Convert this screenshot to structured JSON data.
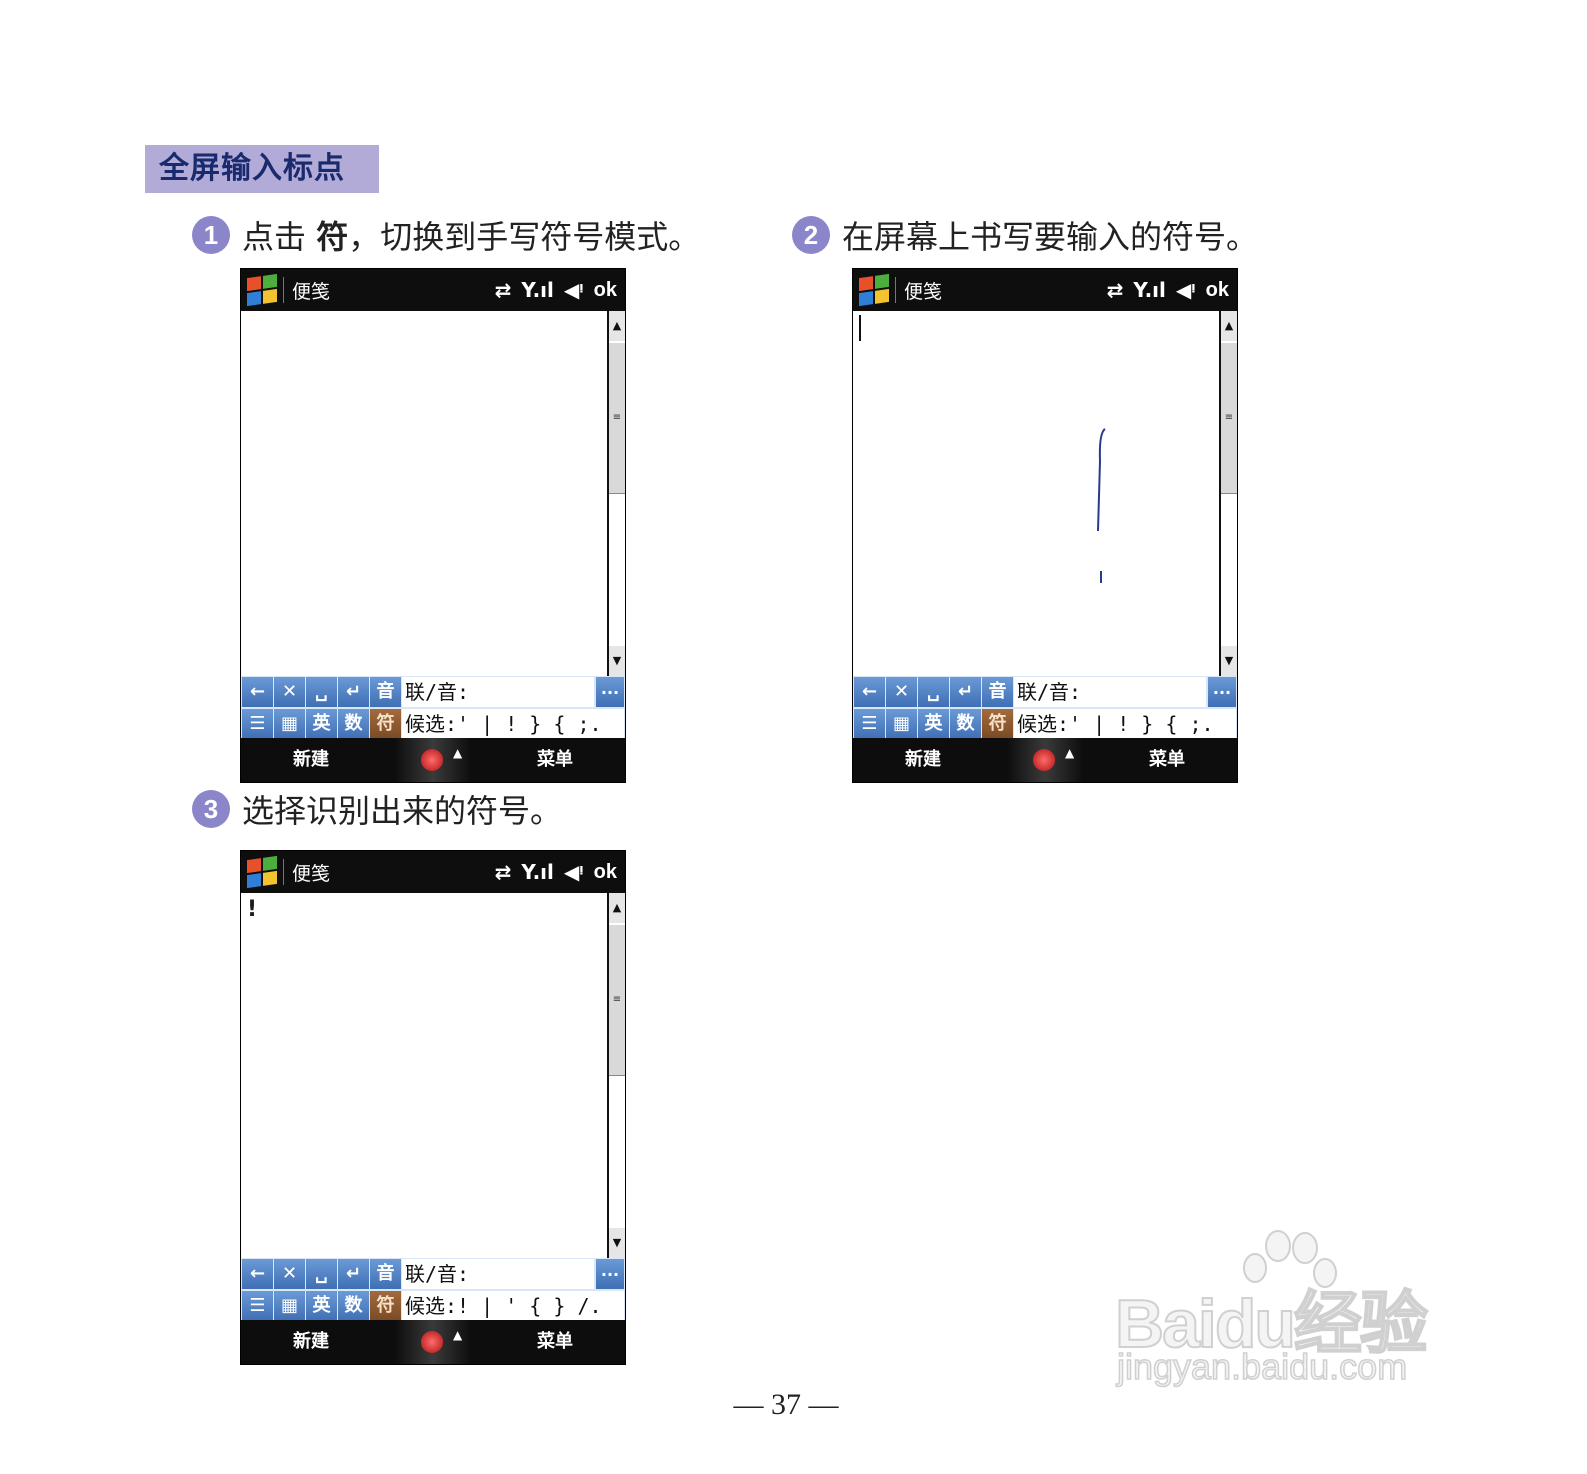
{
  "section_title": "全屏输入标点",
  "steps": [
    {
      "number": "1",
      "text_before": "点击 ",
      "text_bold": "符",
      "text_after": "，切换到手写符号模式。"
    },
    {
      "number": "2",
      "text": "在屏幕上书写要输入的符号。"
    },
    {
      "number": "3",
      "text": "选择识别出来的符号。"
    }
  ],
  "screens": [
    {
      "app_title": "便笺",
      "status_ok": "ok",
      "content_text": "",
      "ime": {
        "keys_row1": [
          "←",
          "✕",
          "␣",
          "↵",
          "音"
        ],
        "keys_row2": [
          "☰",
          "▦",
          "英",
          "数",
          "符"
        ],
        "assoc_label": "联/音:",
        "candidates_label": "候选:",
        "candidates": "' | ! } { ;.",
        "more": "..."
      },
      "softkeys": {
        "left": "新建",
        "right": "菜单"
      }
    },
    {
      "app_title": "便笺",
      "status_ok": "ok",
      "content_text": "",
      "ime": {
        "keys_row1": [
          "←",
          "✕",
          "␣",
          "↵",
          "音"
        ],
        "keys_row2": [
          "☰",
          "▦",
          "英",
          "数",
          "符"
        ],
        "assoc_label": "联/音:",
        "candidates_label": "候选:",
        "candidates": "' | ! } { ;.",
        "more": "..."
      },
      "softkeys": {
        "left": "新建",
        "right": "菜单"
      }
    },
    {
      "app_title": "便笺",
      "status_ok": "ok",
      "content_text": "!",
      "ime": {
        "keys_row1": [
          "←",
          "✕",
          "␣",
          "↵",
          "音"
        ],
        "keys_row2": [
          "☰",
          "▦",
          "英",
          "数",
          "符"
        ],
        "assoc_label": "联/音:",
        "candidates_label": "候选:",
        "candidates": "! | ' { } /.",
        "more": "..."
      },
      "softkeys": {
        "left": "新建",
        "right": "菜单"
      }
    }
  ],
  "page_number": "— 37 —",
  "watermark": {
    "main": "Baidu经验",
    "sub": "jingyan.baidu.com"
  }
}
